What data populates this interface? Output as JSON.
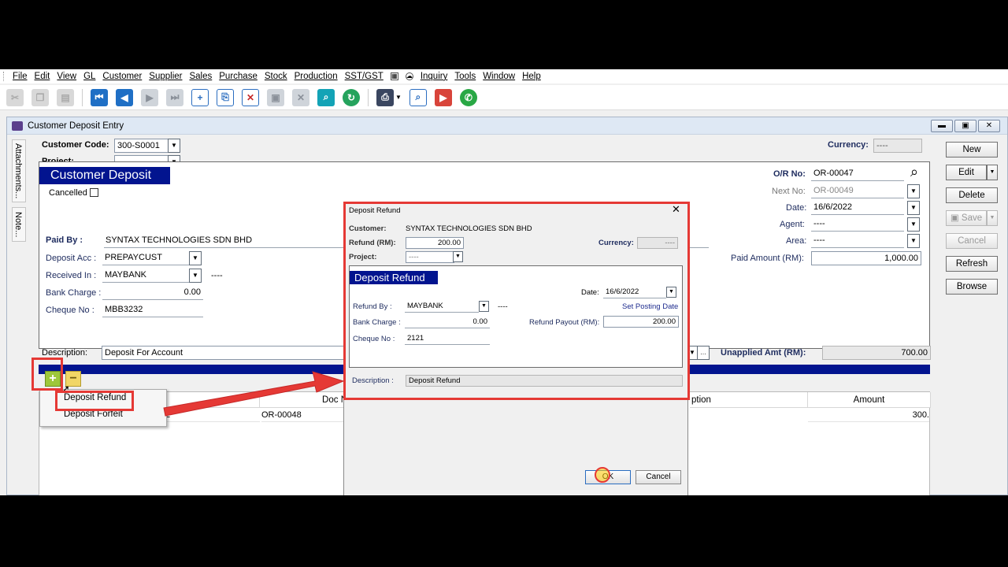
{
  "menu": [
    "File",
    "Edit",
    "View",
    "GL",
    "Customer",
    "Supplier",
    "Sales",
    "Purchase",
    "Stock",
    "Production",
    "SST/GST",
    "Inquiry",
    "Tools",
    "Window",
    "Help"
  ],
  "window": {
    "title": "Customer Deposit Entry",
    "side_tabs": [
      "Attachments...",
      "Note..."
    ]
  },
  "header": {
    "customer_code_label": "Customer Code:",
    "customer_code": "300-S0001",
    "project_label": "Project:",
    "project": "----",
    "currency_label": "Currency:",
    "currency": "----"
  },
  "deposit": {
    "title": "Customer Deposit",
    "cancelled_label": "Cancelled",
    "paid_by_label": "Paid By :",
    "paid_by": "SYNTAX TECHNOLOGIES SDN BHD",
    "deposit_acc_label": "Deposit Acc :",
    "deposit_acc": "PREPAYCUST",
    "received_in_label": "Received In :",
    "received_in": "MAYBANK",
    "received_in_desc": "----",
    "bank_charge_label": "Bank Charge :",
    "bank_charge": "0.00",
    "cheque_no_label": "Cheque No :",
    "cheque_no": "MBB3232",
    "or_no_label": "O/R No:",
    "or_no": "OR-00047",
    "next_no_label": "Next No:",
    "next_no": "OR-00049",
    "date_label": "Date:",
    "date": "16/6/2022",
    "agent_label": "Agent:",
    "agent": "----",
    "area_label": "Area:",
    "area": "----",
    "paid_amount_label": "Paid Amount (RM):",
    "paid_amount": "1,000.00"
  },
  "description_label": "Description:",
  "description": "Deposit For Account",
  "unapplied_label": "Unapplied Amt (RM):",
  "unapplied": "700.00",
  "buttons": {
    "new": "New",
    "edit": "Edit",
    "delete": "Delete",
    "save": "Save",
    "cancel": "Cancel",
    "refresh": "Refresh",
    "browse": "Browse"
  },
  "grid": {
    "headers": {
      "doc_no": "Doc N",
      "description": "ption",
      "amount": "Amount"
    },
    "row": {
      "first": "2",
      "doc_no": "OR-00048",
      "amount": "300."
    }
  },
  "popup": [
    "Deposit Refund",
    "Deposit Forfeit"
  ],
  "dialog": {
    "title": "Deposit Refund",
    "customer_label": "Customer:",
    "customer": "SYNTAX TECHNOLOGIES SDN BHD",
    "refund_label": "Refund (RM):",
    "refund": "200.00",
    "currency_label": "Currency:",
    "currency": "----",
    "project_label": "Project:",
    "project": "----",
    "panel_title": "Deposit Refund",
    "date_label": "Date:",
    "date": "16/6/2022",
    "set_posting_date": "Set Posting Date",
    "refund_by_label": "Refund By :",
    "refund_by": "MAYBANK",
    "refund_by_desc": "----",
    "bank_charge_label": "Bank Charge :",
    "bank_charge": "0.00",
    "refund_payout_label": "Refund Payout (RM):",
    "refund_payout": "200.00",
    "cheque_no_label": "Cheque No :",
    "cheque_no": "2121",
    "description_label": "Description :",
    "description": "Deposit Refund",
    "ok": "OK",
    "cancel": "Cancel"
  },
  "colors": {
    "header_band": "#02148f",
    "highlight": "#e53935",
    "tool_blue": "#1f6fc5"
  }
}
